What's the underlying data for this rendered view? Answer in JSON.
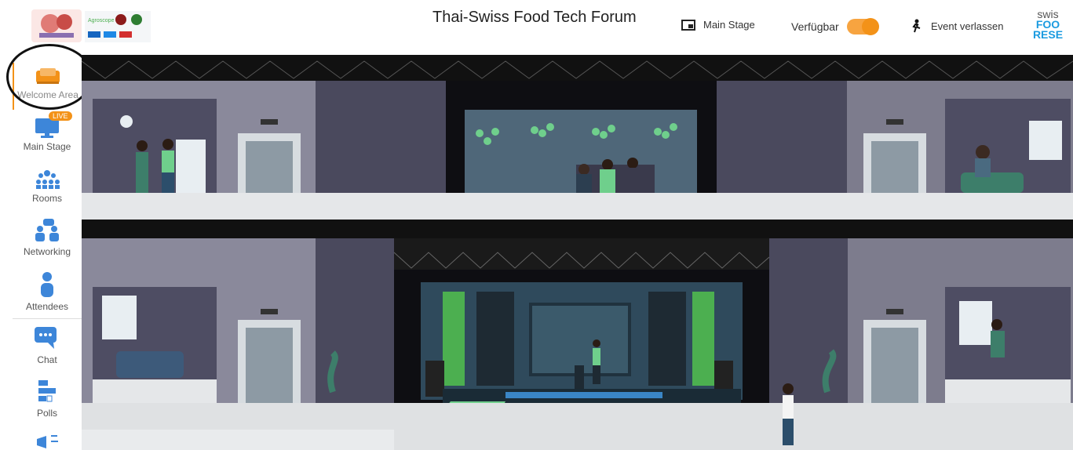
{
  "header": {
    "title": "Thai-Swiss Food Tech Forum",
    "main_stage_label": "Main Stage",
    "availability_label": "Verfügbar",
    "availability_on": true,
    "leave_label": "Event verlassen",
    "brand_logo_lines": [
      "swis",
      "FOO",
      "RESE"
    ]
  },
  "sidebar": {
    "items": [
      {
        "label": "Welcome Area",
        "icon": "sofa-icon",
        "active": true
      },
      {
        "label": "Main Stage",
        "icon": "monitor-icon",
        "badge": "LIVE"
      },
      {
        "label": "Rooms",
        "icon": "rooms-icon"
      },
      {
        "label": "Networking",
        "icon": "networking-icon"
      },
      {
        "label": "Attendees",
        "icon": "person-icon"
      },
      {
        "label": "Chat",
        "icon": "chat-icon"
      },
      {
        "label": "Polls",
        "icon": "polls-icon"
      },
      {
        "label": "",
        "icon": "megaphone-icon"
      }
    ]
  },
  "colors": {
    "accent": "#f39218",
    "icon_blue": "#3d86d9",
    "wall_dark": "#4c4b5e",
    "wall_mid": "#7a7a8c",
    "green": "#5fbf7b"
  }
}
